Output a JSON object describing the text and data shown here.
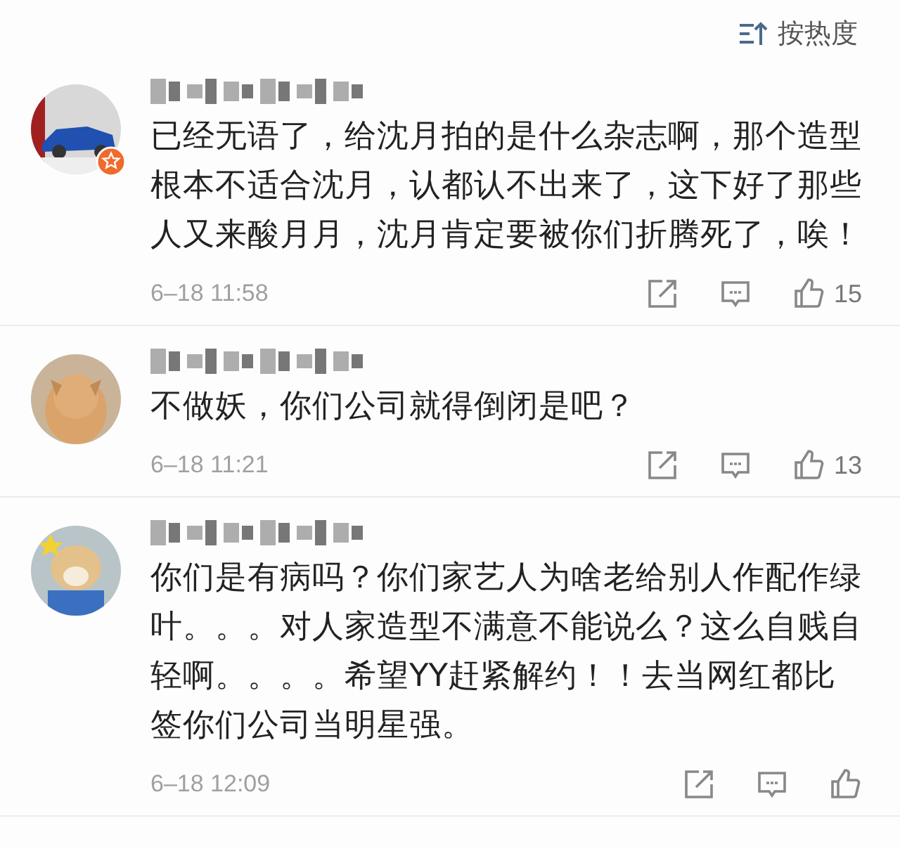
{
  "sort": {
    "label": "按热度"
  },
  "comments": [
    {
      "author_name_pixelated": true,
      "badge": true,
      "text": "已经无语了，给沈月拍的是什么杂志啊，那个造型根本不适合沈月，认都认不出来了，这下好了那些人又来酸月月，沈月肯定要被你们折腾死了，唉！",
      "time": "6–18 11:58",
      "likes": "15"
    },
    {
      "author_name_pixelated": true,
      "badge": false,
      "text": "不做妖，你们公司就得倒闭是吧？",
      "time": "6–18 11:21",
      "likes": "13"
    },
    {
      "author_name_pixelated": true,
      "badge": false,
      "text": "你们是有病吗？你们家艺人为啥老给别人作配作绿叶。。。对人家造型不满意不能说么？这么自贱自轻啊。。。。希望YY赶紧解约！！去当网红都比签你们公司当明星强。",
      "time": "6–18 12:09"
    }
  ]
}
